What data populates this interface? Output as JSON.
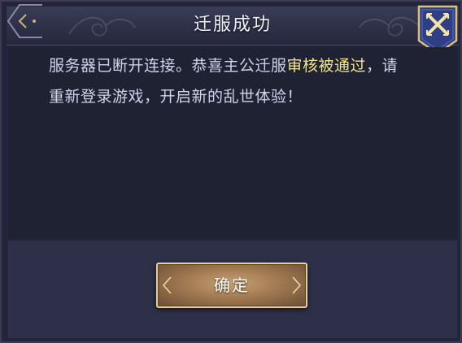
{
  "dialog": {
    "title": "迁服成功",
    "message_part1": "服务器已断开连接。恭喜主公迁服",
    "message_highlight": "审核被通过",
    "message_part2": "，请重新登录游戏，开启新的乱世体验！",
    "confirm_label": "确定"
  },
  "icons": {
    "back": "back-arrow-icon",
    "close": "close-cross-icon"
  },
  "colors": {
    "background": "#23263a",
    "message_text": "#cfd3ec",
    "highlight_text": "#f3e58a",
    "gold_border": "#e8cf93",
    "button_fill": "#a17a52"
  }
}
